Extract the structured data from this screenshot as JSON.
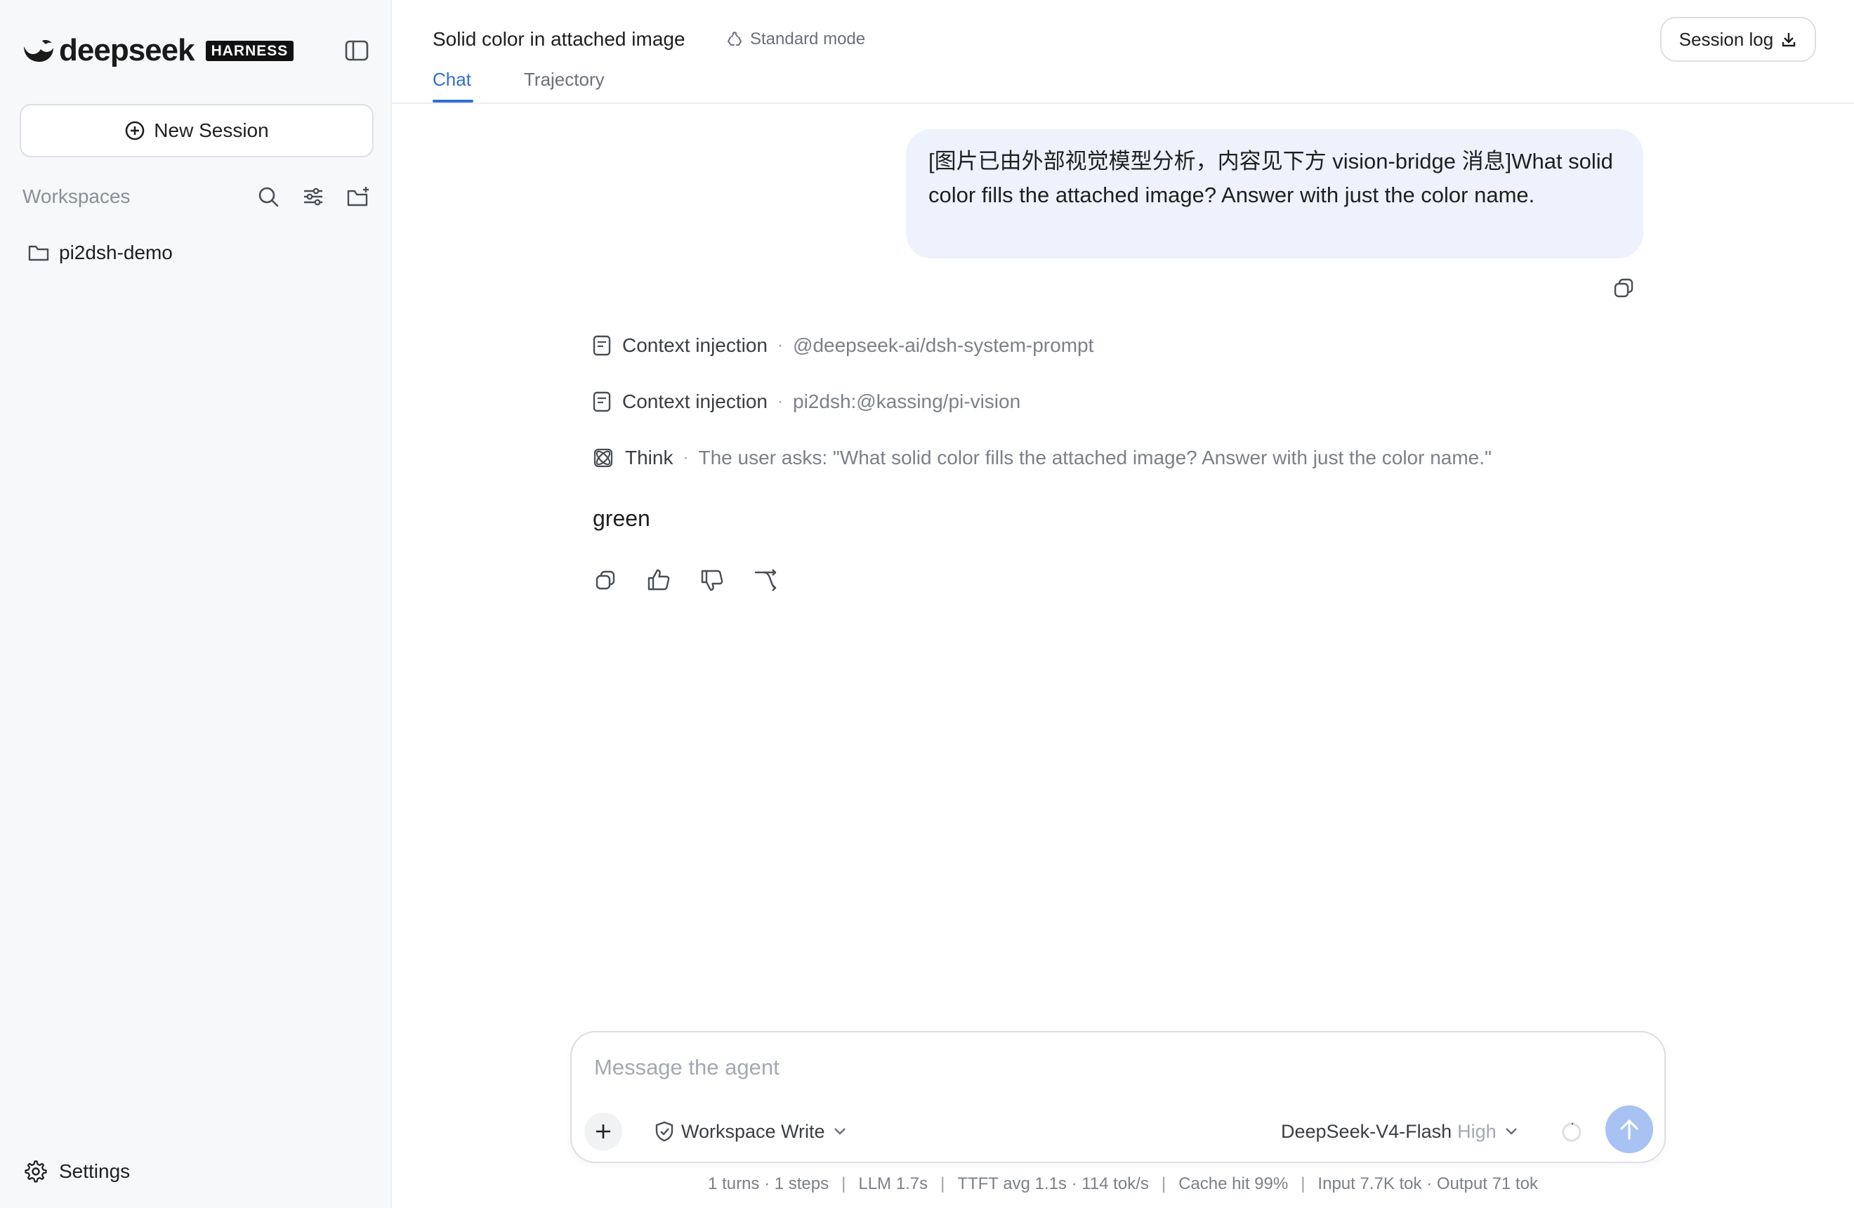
{
  "sidebar": {
    "logo_text": "deepseek",
    "logo_badge": "HARNESS",
    "new_session_label": "New Session",
    "workspaces_title": "Workspaces",
    "workspaces": [
      {
        "label": "pi2dsh-demo",
        "icon": "folder-icon"
      }
    ],
    "settings_label": "Settings"
  },
  "header": {
    "title": "Solid color in attached image",
    "mode": "Standard mode",
    "tabs": [
      {
        "label": "Chat",
        "active": true
      },
      {
        "label": "Trajectory",
        "active": false
      }
    ],
    "session_log_label": "Session log"
  },
  "conversation": {
    "user_message": "[图片已由外部视觉模型分析，内容见下方 vision-bridge 消息]What solid color fills the attached image? Answer with just the color name.",
    "steps": [
      {
        "name": "Context injection",
        "detail": "@deepseek-ai/dsh-system-prompt",
        "icon": "document-icon"
      },
      {
        "name": "Context injection",
        "detail": "pi2dsh:@kassing/pi-vision",
        "icon": "document-icon"
      },
      {
        "name": "Think",
        "detail": "The user asks: \"What solid color fills the attached image? Answer with just the color name.\"",
        "icon": "atom-icon"
      }
    ],
    "answer": "green"
  },
  "composer": {
    "placeholder": "Message the agent",
    "value": "",
    "permission": "Workspace Write",
    "model_name": "DeepSeek-V4-Flash",
    "model_level": "High"
  },
  "stats": {
    "turns": "1 turns · 1 steps",
    "llm": "LLM 1.7s",
    "ttft": "TTFT avg 1.1s · 114 tok/s",
    "cache": "Cache hit 99%",
    "tokens": "Input 7.7K tok · Output 71 tok"
  },
  "colors": {
    "accent": "#2f6fd6",
    "user_bubble": "#edf2fd",
    "send_button": "#a8c3f3",
    "sidebar_bg": "#f7f8fa"
  }
}
